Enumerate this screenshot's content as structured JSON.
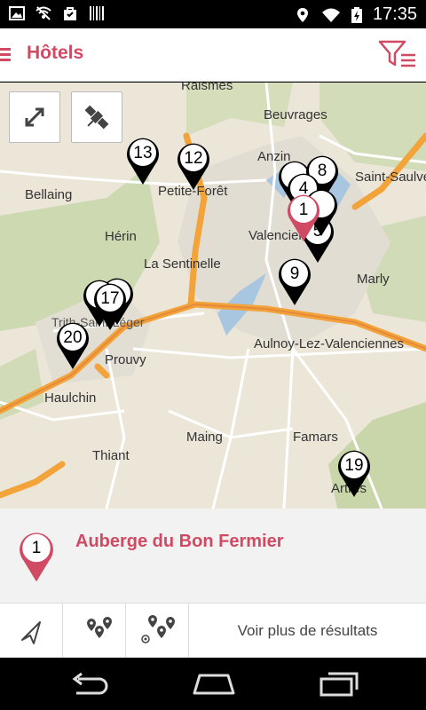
{
  "status_bar": {
    "time": "17:35"
  },
  "app_bar": {
    "title": "Hôtels"
  },
  "map": {
    "places": [
      "Raismes",
      "Beuvrages",
      "Anzin",
      "Saint-Saulve",
      "Bellaing",
      "Petite-Forêt",
      "Hérin",
      "Valenciennes",
      "La Sentinelle",
      "Marly",
      "Aulnoy-Lez-Valenciennes",
      "Prouvy",
      "Haulchin",
      "Maing",
      "Famars",
      "Thiant",
      "Artres",
      "Trith-Saint-Léger"
    ],
    "pins": [
      "13",
      "12",
      "8",
      "4",
      "1",
      "5",
      "9",
      "17",
      "20",
      "19"
    ]
  },
  "detail": {
    "pin_number": "1",
    "hotel_name": "Auberge du Bon Fermier"
  },
  "toolbar": {
    "more_label": "Voir plus de résultats"
  }
}
